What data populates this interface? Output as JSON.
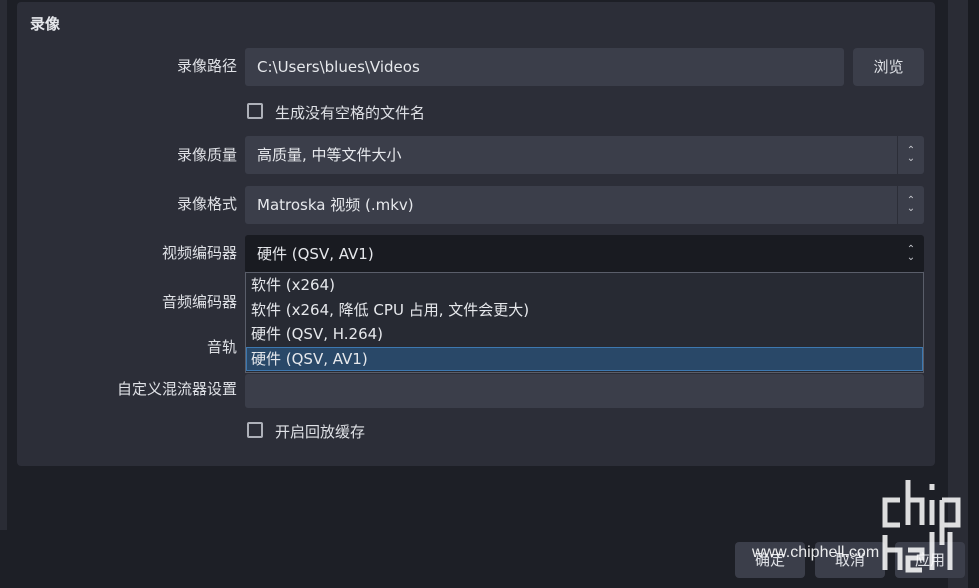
{
  "section": {
    "title": "录像"
  },
  "fields": {
    "path": {
      "label": "录像路径",
      "value": "C:\\Users\\blues\\Videos",
      "browse_label": "浏览"
    },
    "no_space": {
      "label": "生成没有空格的文件名",
      "checked": false
    },
    "quality": {
      "label": "录像质量",
      "value": "高质量, 中等文件大小"
    },
    "format": {
      "label": "录像格式",
      "value": "Matroska 视频 (.mkv)"
    },
    "video_encoder": {
      "label": "视频编码器",
      "value": "硬件 (QSV, AV1)"
    },
    "audio_encoder": {
      "label": "音频编码器"
    },
    "audio_track": {
      "label": "音轨"
    },
    "muxer": {
      "label": "自定义混流器设置",
      "value": ""
    },
    "replay_buffer": {
      "label": "开启回放缓存",
      "checked": false
    }
  },
  "encoder_dropdown": {
    "options": [
      "软件 (x264)",
      "软件 (x264, 降低 CPU 占用, 文件会更大)",
      "硬件 (QSV, H.264)",
      "硬件 (QSV, AV1)"
    ],
    "selected_index": 3
  },
  "footer": {
    "ok_label": "确定",
    "cancel_label": "取消",
    "apply_label": "应用"
  },
  "watermark": {
    "text": "www.chiphell.com",
    "logo_text": "chip hell"
  },
  "colors": {
    "selected": "#294868",
    "panel": "#2c2e38",
    "field": "#3b3e4a"
  }
}
